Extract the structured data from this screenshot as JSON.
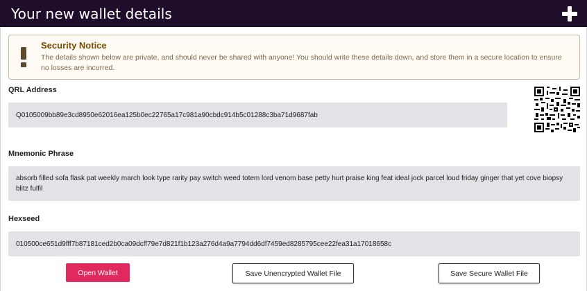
{
  "header": {
    "title": "Your new wallet details",
    "add_icon": "plus-icon"
  },
  "notice": {
    "icon": "exclamation-icon",
    "title": "Security Notice",
    "text": "The details shown below are private, and should never be shared with anyone! You should write these details down, and store them in a secure location to ensure no losses are incurred."
  },
  "address": {
    "label": "QRL Address",
    "value": "Q0105009bb89e3cd8950e62016ea125b0ec22765a17c981a90cbdc914b5c01288c3ba71d9687fab",
    "qr_icon": "qr-code-icon"
  },
  "mnemonic": {
    "label": "Mnemonic Phrase",
    "value": "absorb filled sofa flask pat weekly march look type rarity pay switch weed totem lord venom base petty hurt praise king feat ideal jock parcel loud friday ginger that yet cove biopsy blitz fulfil"
  },
  "hexseed": {
    "label": "Hexseed",
    "value": "010500ce651d9fff7b87181ced2b0ca09dcff79e7d821f1b123a276d4a9a7794dd6df7459ed8285795cee22fea31a17018658c"
  },
  "buttons": {
    "open_wallet": "Open Wallet",
    "save_unencrypted": "Save Unencrypted Wallet File",
    "save_secure": "Save Secure Wallet File"
  },
  "colors": {
    "header_bg": "#1e0d2b",
    "primary": "#e0295c",
    "notice_title": "#794b02",
    "field_bg": "#e3e2e6"
  }
}
